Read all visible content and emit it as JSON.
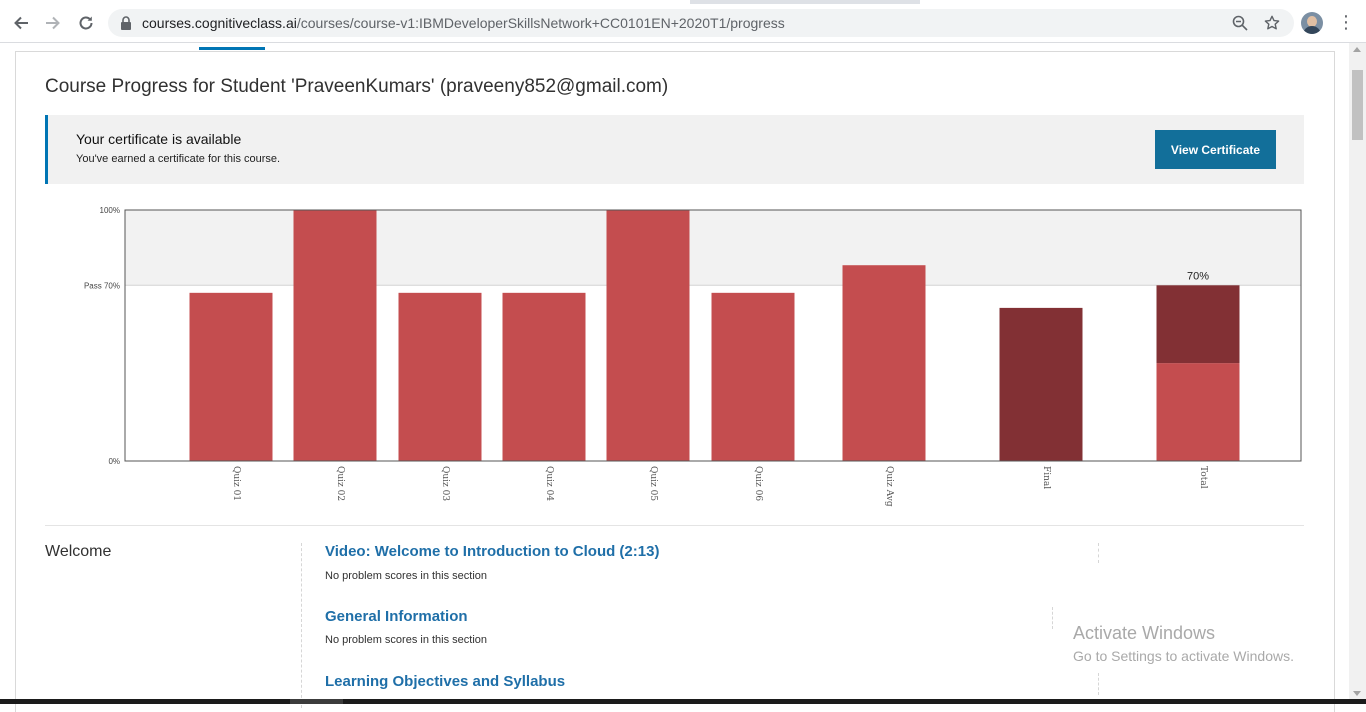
{
  "browser": {
    "url_host": "courses.cognitiveclass.ai",
    "url_path": "/courses/course-v1:IBMDeveloperSkillsNetwork+CC0101EN+2020T1/progress",
    "icons": [
      "back-arrow-icon",
      "forward-arrow-icon",
      "reload-icon",
      "lock-icon",
      "zoom-icon",
      "star-icon",
      "profile-avatar",
      "menu-icon"
    ]
  },
  "page": {
    "title": "Course Progress for Student 'PraveenKumars' (praveeny852@gmail.com)"
  },
  "certificate": {
    "heading": "Your certificate is available",
    "subtext": "You've earned a certificate for this course.",
    "button_label": "View Certificate"
  },
  "chart_data": {
    "type": "bar",
    "categories": [
      "Quiz 01",
      "Quiz 02",
      "Quiz 03",
      "Quiz 04",
      "Quiz 05",
      "Quiz 06",
      "Quiz Avg",
      "Final",
      "Total"
    ],
    "values": [
      67,
      100,
      67,
      67,
      100,
      67,
      78,
      61,
      70
    ],
    "total_breakdown": {
      "quiz_portion": 39,
      "final_portion": 31
    },
    "total_label": "70%",
    "ylim": [
      0,
      100
    ],
    "y_ticks": [
      {
        "value": 100,
        "label": "100%"
      },
      {
        "value": 70,
        "label": "Pass 70%"
      },
      {
        "value": 0,
        "label": "0%"
      }
    ],
    "pass_threshold": 70,
    "colors": {
      "quiz": "#c44d4f",
      "final": "#823034",
      "pass_band": "#f2f2f2",
      "axis": "#555555"
    }
  },
  "progress": {
    "chapter": "Welcome",
    "sections": [
      {
        "title": "Video: Welcome to Introduction to Cloud (2:13)",
        "note": "No problem scores in this section"
      },
      {
        "title": "General Information",
        "note": "No problem scores in this section"
      },
      {
        "title": "Learning Objectives and Syllabus",
        "note": ""
      }
    ]
  },
  "watermark": {
    "line1": "Activate Windows",
    "line2": "Go to Settings to activate Windows."
  }
}
